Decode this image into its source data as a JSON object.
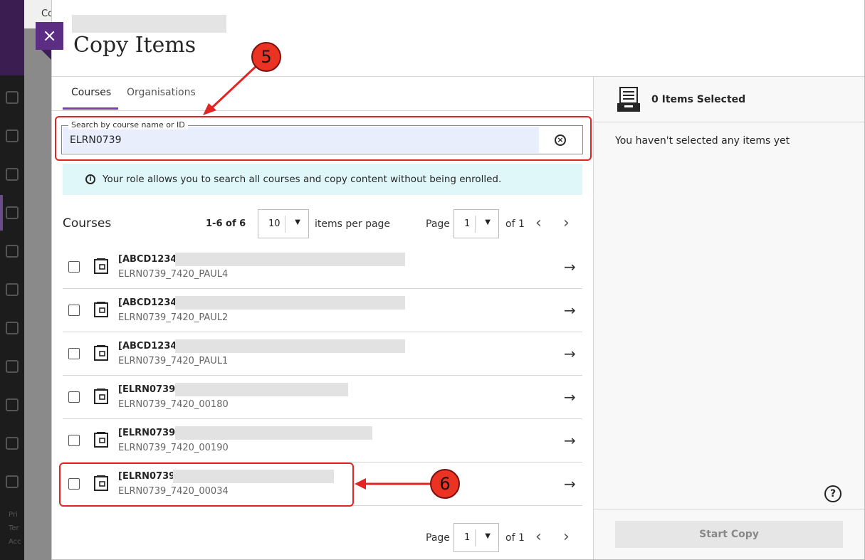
{
  "background_app": {
    "tab_label": "Co",
    "footer_lines": [
      "Pri",
      "Ter",
      "Acc"
    ]
  },
  "panel": {
    "close_symbol": "×",
    "title": "Copy Items"
  },
  "tabs": [
    {
      "label": "Courses",
      "active": true
    },
    {
      "label": "Organisations",
      "active": false
    }
  ],
  "search": {
    "label": "Search by course name or ID",
    "value": "ELRN0739",
    "clear_symbol": "×"
  },
  "info": {
    "icon": "i",
    "text": "Your role allows you to search all courses and copy content without being enrolled."
  },
  "list_header": {
    "heading": "Courses",
    "range": "1-6 of 6",
    "per_page_value": "10",
    "per_page_label": "items per page",
    "page_label": "Page",
    "page_value": "1",
    "of_label": "of 1"
  },
  "courses": [
    {
      "code": "[ABCD1234]",
      "id": "ELRN0739_7420_PAUL4"
    },
    {
      "code": "[ABCD1234]",
      "id": "ELRN0739_7420_PAUL2"
    },
    {
      "code": "[ABCD1234]",
      "id": "ELRN0739_7420_PAUL1"
    },
    {
      "code": "[ELRN0739]",
      "id": "ELRN0739_7420_00180"
    },
    {
      "code": "[ELRN0739]",
      "id": "ELRN0739_7420_00190"
    },
    {
      "code": "[ELRN0739]",
      "id": "ELRN0739_7420_00034"
    }
  ],
  "icons": {
    "close": "close-icon",
    "clear": "clear-circle-icon",
    "info": "info-circle-icon",
    "course": "course-book-icon",
    "go": "arrow-right-icon",
    "tray": "items-tray-icon",
    "help": "help-icon"
  },
  "selection": {
    "count_label": "0 Items Selected",
    "empty_message": "You haven't selected any items yet",
    "help_symbol": "?",
    "start_label": "Start Copy"
  },
  "footer": {
    "page_label": "Page",
    "page_value": "1",
    "of_label": "of 1"
  },
  "annotations": [
    {
      "number": "5",
      "color": "#e32424"
    },
    {
      "number": "6",
      "color": "#e32424"
    }
  ]
}
